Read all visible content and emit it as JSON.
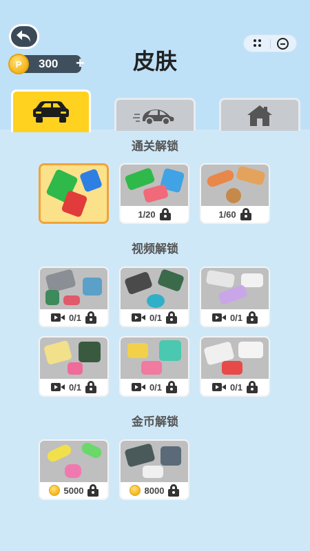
{
  "header": {
    "title": "皮肤",
    "coins": "300",
    "coin_plus": "+",
    "coin_symbol": "P"
  },
  "tabs": [
    {
      "name": "car",
      "active": true
    },
    {
      "name": "racecar",
      "active": false
    },
    {
      "name": "house",
      "active": false
    }
  ],
  "sections": {
    "level": {
      "title": "通关解锁",
      "items": [
        {
          "label": "",
          "selected": true
        },
        {
          "label": "1/20",
          "selected": false
        },
        {
          "label": "1/60",
          "selected": false
        }
      ]
    },
    "video": {
      "title": "视频解锁",
      "items": [
        {
          "label": "0/1"
        },
        {
          "label": "0/1"
        },
        {
          "label": "0/1"
        },
        {
          "label": "0/1"
        },
        {
          "label": "0/1"
        },
        {
          "label": "0/1"
        }
      ]
    },
    "coin": {
      "title": "金币解锁",
      "items": [
        {
          "label": "5000"
        },
        {
          "label": "8000"
        }
      ]
    }
  },
  "colors": {
    "background": "#cfe8f8",
    "tab_active": "#ffd21f",
    "selected_border": "#f2a238"
  }
}
